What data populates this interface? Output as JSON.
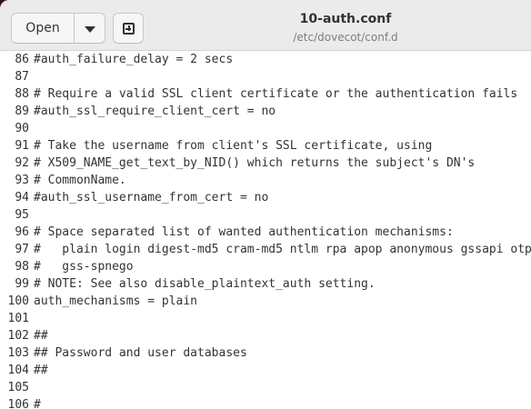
{
  "header": {
    "open_label": "Open",
    "title": "10-auth.conf",
    "subtitle": "/etc/dovecot/conf.d"
  },
  "editor": {
    "lines": [
      {
        "n": "86",
        "text": "#auth_failure_delay = 2 secs"
      },
      {
        "n": "87",
        "text": ""
      },
      {
        "n": "88",
        "text": "# Require a valid SSL client certificate or the authentication fails"
      },
      {
        "n": "89",
        "text": "#auth_ssl_require_client_cert = no"
      },
      {
        "n": "90",
        "text": ""
      },
      {
        "n": "91",
        "text": "# Take the username from client's SSL certificate, using"
      },
      {
        "n": "92",
        "text": "# X509_NAME_get_text_by_NID() which returns the subject's DN's"
      },
      {
        "n": "93",
        "text": "# CommonName."
      },
      {
        "n": "94",
        "text": "#auth_ssl_username_from_cert = no"
      },
      {
        "n": "95",
        "text": ""
      },
      {
        "n": "96",
        "text": "# Space separated list of wanted authentication mechanisms:"
      },
      {
        "n": "97",
        "text": "#   plain login digest-md5 cram-md5 ntlm rpa apop anonymous gssapi otp"
      },
      {
        "n": "98",
        "text": "#   gss-spnego"
      },
      {
        "n": "99",
        "text": "# NOTE: See also disable_plaintext_auth setting."
      },
      {
        "n": "100",
        "text": "auth_mechanisms = plain"
      },
      {
        "n": "101",
        "text": ""
      },
      {
        "n": "102",
        "text": "##"
      },
      {
        "n": "103",
        "text": "## Password and user databases"
      },
      {
        "n": "104",
        "text": "##"
      },
      {
        "n": "105",
        "text": ""
      },
      {
        "n": "106",
        "text": "#"
      }
    ]
  }
}
